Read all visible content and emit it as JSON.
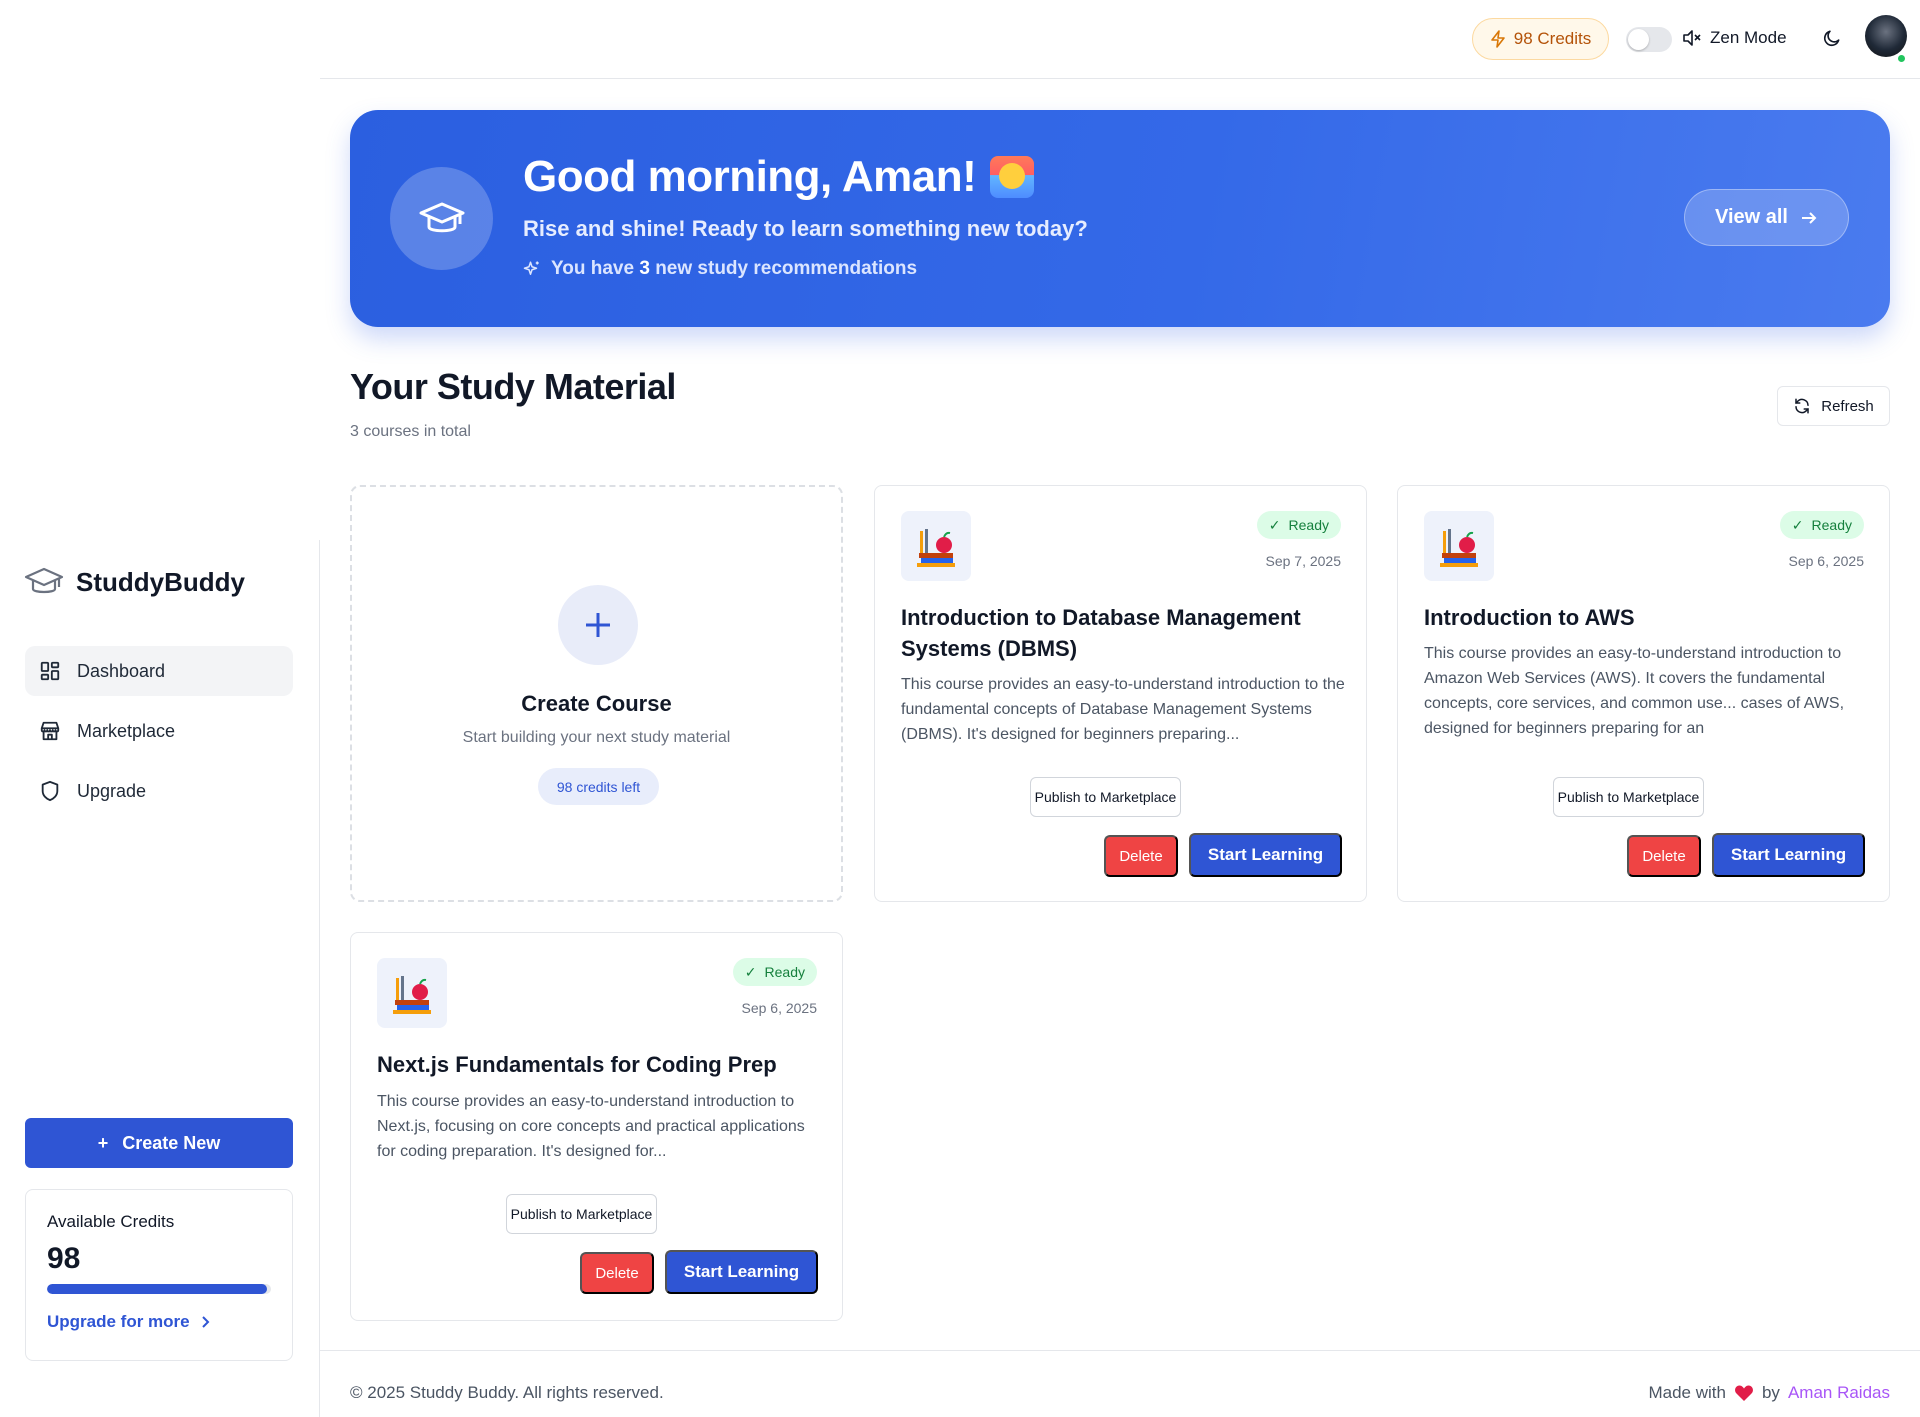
{
  "app": {
    "name": "StuddyBuddy"
  },
  "header": {
    "credits_label": "98 Credits",
    "zen_mode_label": "Zen Mode",
    "zen_mode_on": false
  },
  "sidebar": {
    "items": [
      {
        "label": "Dashboard",
        "icon": "dashboard-grid-icon",
        "active": true
      },
      {
        "label": "Marketplace",
        "icon": "store-icon",
        "active": false
      },
      {
        "label": "Upgrade",
        "icon": "shield-icon",
        "active": false
      }
    ],
    "create_new_label": "Create New",
    "credits": {
      "title": "Available Credits",
      "value": "98",
      "progress_fraction": 0.98,
      "upgrade_label": "Upgrade for more"
    }
  },
  "hero": {
    "greeting": "Good morning, Aman!",
    "subtitle": "Rise and shine! Ready to learn something new today?",
    "rec_prefix": "You have",
    "rec_count": "3",
    "rec_suffix": "new study recommendations",
    "view_all_label": "View all"
  },
  "section": {
    "title": "Your Study Material",
    "subtitle": "3 courses in total",
    "refresh_label": "Refresh"
  },
  "create_card": {
    "title": "Create Course",
    "subtitle": "Start building your next study material",
    "credits_left": "98 credits left"
  },
  "courses": [
    {
      "status": "Ready",
      "date": "Sep 7, 2025",
      "title": "Introduction to Database Management Systems (DBMS)",
      "description": "This course provides an easy-to-understand introduction to the fundamental concepts of Database Management Systems (DBMS). It's designed for beginners preparing...",
      "publish_label": "Publish to Marketplace",
      "delete_label": "Delete",
      "start_label": "Start Learning"
    },
    {
      "status": "Ready",
      "date": "Sep 6, 2025",
      "title": "Introduction to AWS",
      "description": "This course provides an easy-to-understand introduction to Amazon Web Services (AWS). It covers the fundamental concepts, core services, and common use... cases of AWS, designed for beginners preparing for an",
      "publish_label": "Publish to Marketplace",
      "delete_label": "Delete",
      "start_label": "Start Learning"
    },
    {
      "status": "Ready",
      "date": "Sep 6, 2025",
      "title": "Next.js Fundamentals for Coding Prep",
      "description": "This course provides an easy-to-understand introduction to Next.js, focusing on core concepts and practical applications for coding preparation. It's designed for...",
      "publish_label": "Publish to Marketplace",
      "delete_label": "Delete",
      "start_label": "Start Learning"
    }
  ],
  "footer": {
    "copyright": "© 2025 Studdy Buddy. All rights reserved.",
    "made_with": "Made with",
    "by": "by",
    "author": "Aman Raidas"
  },
  "colors": {
    "primary": "#2f55d4",
    "danger": "#ef4444",
    "success_bg": "#dcfce7",
    "hero_gradient_start": "#2b5fe0",
    "hero_gradient_end": "#4a7bef"
  }
}
